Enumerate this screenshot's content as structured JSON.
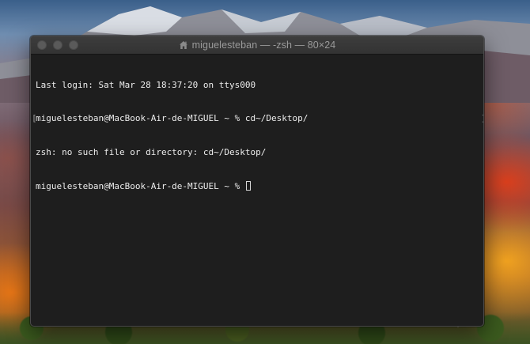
{
  "window": {
    "title": "miguelesteban — -zsh — 80×24",
    "title_icon": "home-icon"
  },
  "terminal": {
    "lines": [
      "Last login: Sat Mar 28 18:37:20 on ttys000",
      "miguelesteban@MacBook-Air-de-MIGUEL ~ % cd~/Desktop/",
      "zsh: no such file or directory: cd~/Desktop/",
      "miguelesteban@MacBook-Air-de-MIGUEL ~ % "
    ],
    "bracket_open": "[",
    "bracket_close": "]"
  },
  "colors": {
    "terminal_bg": "#1e1e1e",
    "terminal_text": "#ececec",
    "titlebar": "#383838",
    "traffic_light_inactive": "#5a5a5a"
  }
}
